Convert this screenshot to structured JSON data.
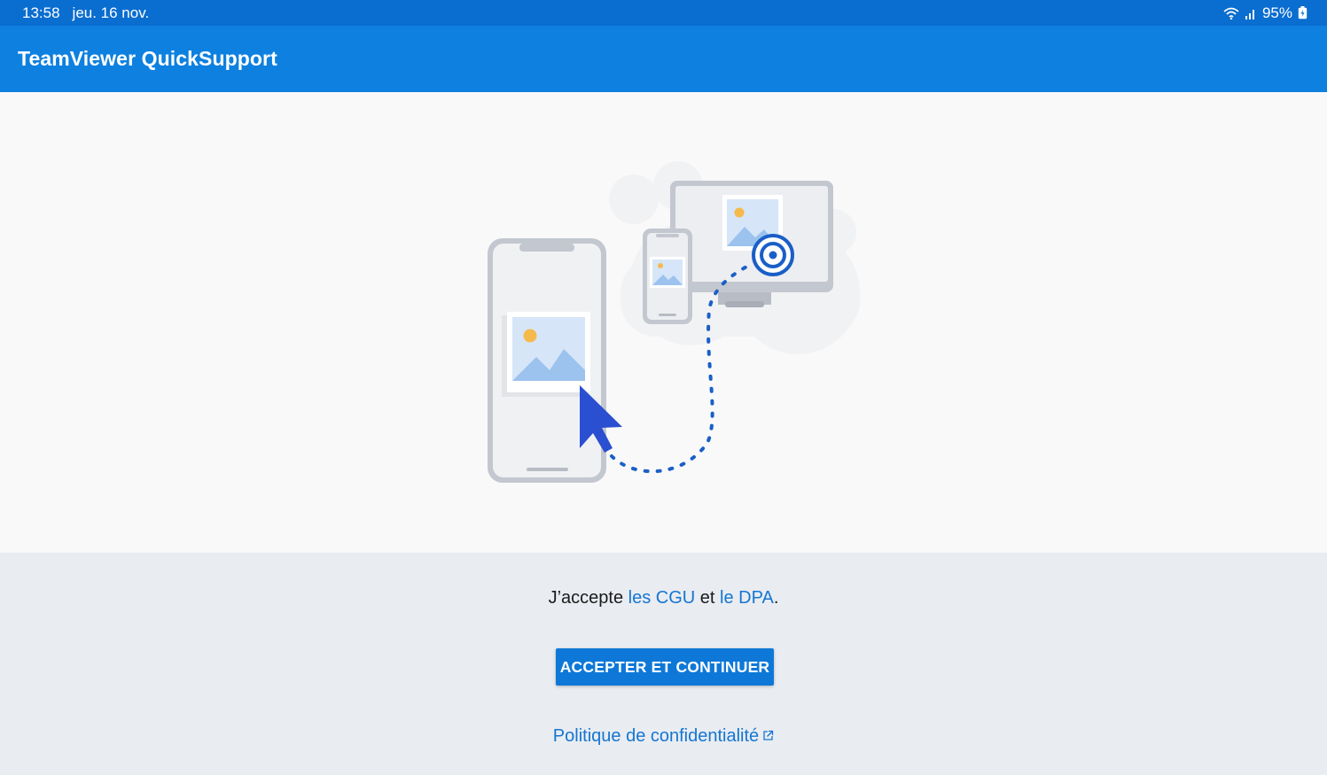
{
  "status_bar": {
    "time": "13:58",
    "date": "jeu. 16 nov.",
    "battery": "95%",
    "icons": [
      "wifi-icon",
      "signal-icon",
      "battery-icon"
    ]
  },
  "app_bar": {
    "title": "TeamViewer QuickSupport"
  },
  "illustration": {
    "icons": [
      "phone-icon",
      "cursor-icon",
      "small-phone-icon",
      "monitor-icon",
      "target-icon"
    ]
  },
  "terms": {
    "prefix": "J’accepte ",
    "cgu_link": "les CGU",
    "middle": " et ",
    "dpa_link": "le DPA",
    "suffix": "."
  },
  "accept_button": {
    "label": "ACCEPTER ET CONTINUER"
  },
  "privacy_link": {
    "label": "Politique de confidentialité",
    "icon": "external-link-icon"
  },
  "colors": {
    "status_bar": "#0a6dd0",
    "app_bar": "#0e80e0",
    "button": "#0e78d8",
    "link": "#1476d2",
    "hero_bg": "#f9f9fa",
    "bottom_bg": "#e9ecf1"
  }
}
